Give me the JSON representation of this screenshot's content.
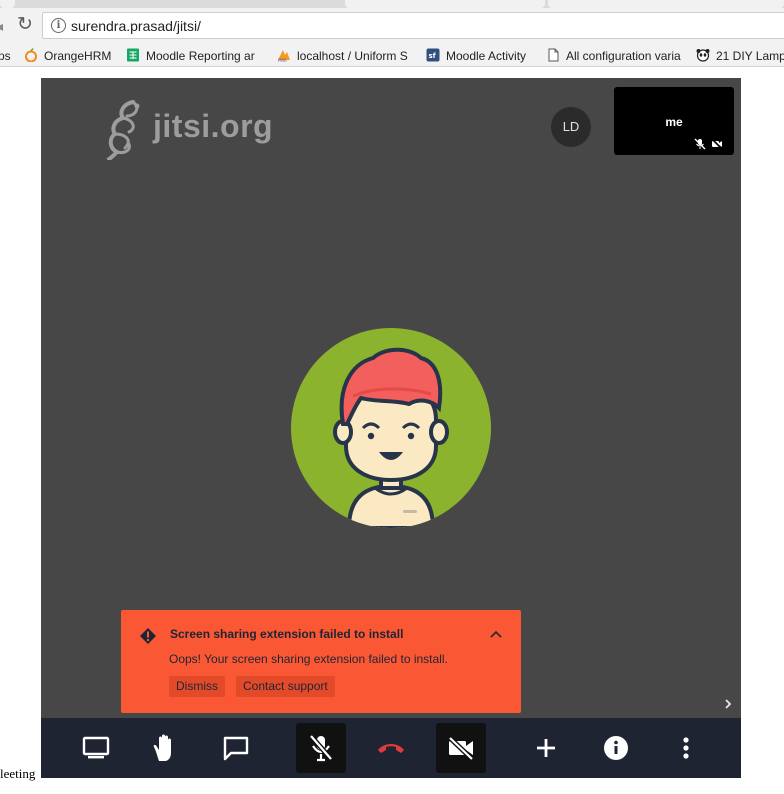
{
  "browser": {
    "url": "surendra.prasad/jitsi/",
    "bookmarks": [
      {
        "label": "ps",
        "icon": "apps-icon"
      },
      {
        "label": "OrangeHRM",
        "icon": "orangehrm-icon"
      },
      {
        "label": "Moodle Reporting ar",
        "icon": "sheets-icon"
      },
      {
        "label": "localhost / Uniform S",
        "icon": "phpmyadmin-icon"
      },
      {
        "label": "Moodle Activity",
        "icon": "sf-icon"
      },
      {
        "label": "All configuration varia",
        "icon": "page-icon"
      },
      {
        "label": "21 DIY Lamp",
        "icon": "panda-icon"
      }
    ]
  },
  "meeting": {
    "watermark": "jitsi.org",
    "participant_initials": "LD",
    "local_video_label": "me",
    "notification": {
      "title": "Screen sharing extension failed to install",
      "message": "Oops! Your screen sharing extension failed to install.",
      "dismiss_label": "Dismiss",
      "support_label": "Contact support"
    },
    "toolbar": [
      {
        "name": "screenshare",
        "icon": "desktop-icon",
        "active": false
      },
      {
        "name": "raise-hand",
        "icon": "hand-icon",
        "active": false
      },
      {
        "name": "chat",
        "icon": "chat-icon",
        "active": false
      },
      {
        "name": "microphone",
        "icon": "mic-muted-icon",
        "active": true
      },
      {
        "name": "hangup",
        "icon": "hangup-icon",
        "active": false
      },
      {
        "name": "camera",
        "icon": "camera-off-icon",
        "active": true
      },
      {
        "name": "invite",
        "icon": "plus-icon",
        "active": false
      },
      {
        "name": "info",
        "icon": "info-icon",
        "active": false
      },
      {
        "name": "more",
        "icon": "more-icon",
        "active": false
      }
    ],
    "colors": {
      "stage": "#474747",
      "toolbar": "#1f2433",
      "notification": "#fa5835",
      "hangup": "#e03b3b",
      "avatar_bg": "#8bb32d"
    }
  },
  "page": {
    "cut_text": "leeting"
  }
}
